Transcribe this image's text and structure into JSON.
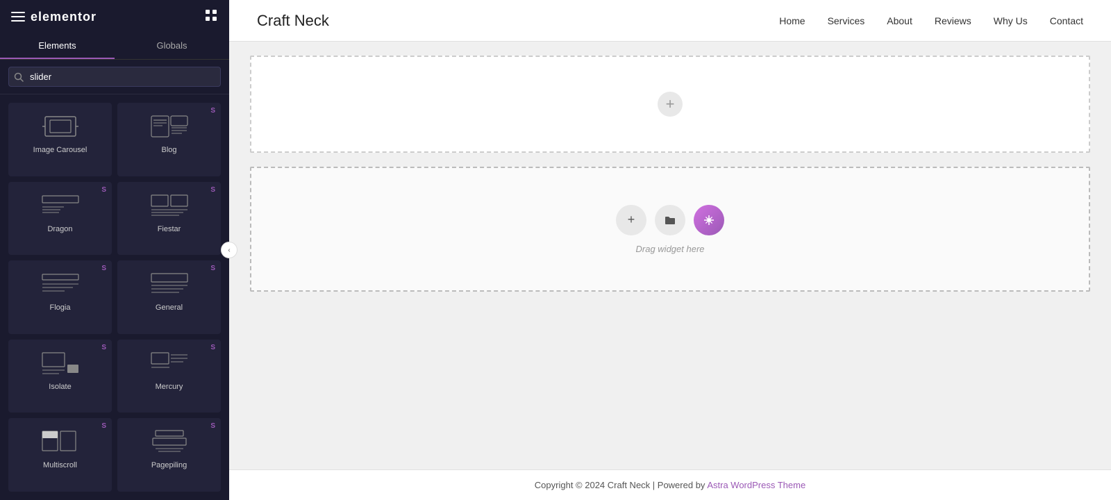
{
  "sidebar": {
    "logo": "elementor",
    "tabs": [
      {
        "id": "elements",
        "label": "Elements",
        "active": true
      },
      {
        "id": "globals",
        "label": "Globals",
        "active": false
      }
    ],
    "search": {
      "placeholder": "slider",
      "value": "slider"
    },
    "widgets": [
      {
        "id": "image-carousel",
        "label": "Image Carousel",
        "pro": false,
        "icon": "image-carousel"
      },
      {
        "id": "blog",
        "label": "Blog",
        "pro": true,
        "icon": "blog"
      },
      {
        "id": "dragon",
        "label": "Dragon",
        "pro": true,
        "icon": "dragon"
      },
      {
        "id": "fiestar",
        "label": "Fiestar",
        "pro": true,
        "icon": "fiestar"
      },
      {
        "id": "flogia",
        "label": "Flogia",
        "pro": true,
        "icon": "flogia"
      },
      {
        "id": "general",
        "label": "General",
        "pro": true,
        "icon": "general"
      },
      {
        "id": "isolate",
        "label": "Isolate",
        "pro": true,
        "icon": "isolate"
      },
      {
        "id": "mercury",
        "label": "Mercury",
        "pro": true,
        "icon": "mercury"
      },
      {
        "id": "multiscroll",
        "label": "Multiscroll",
        "pro": true,
        "icon": "multiscroll"
      },
      {
        "id": "pagepiling",
        "label": "Pagepiling",
        "pro": true,
        "icon": "pagepiling"
      }
    ]
  },
  "nav": {
    "site_title": "Craft Neck",
    "links": [
      {
        "id": "home",
        "label": "Home"
      },
      {
        "id": "services",
        "label": "Services"
      },
      {
        "id": "about",
        "label": "About"
      },
      {
        "id": "reviews",
        "label": "Reviews"
      },
      {
        "id": "why-us",
        "label": "Why Us"
      },
      {
        "id": "contact",
        "label": "Contact"
      }
    ]
  },
  "canvas": {
    "drop_zone_text": "Drag widget here"
  },
  "footer": {
    "text": "Copyright © 2024 Craft Neck | Powered by ",
    "link_text": "Astra WordPress Theme"
  }
}
